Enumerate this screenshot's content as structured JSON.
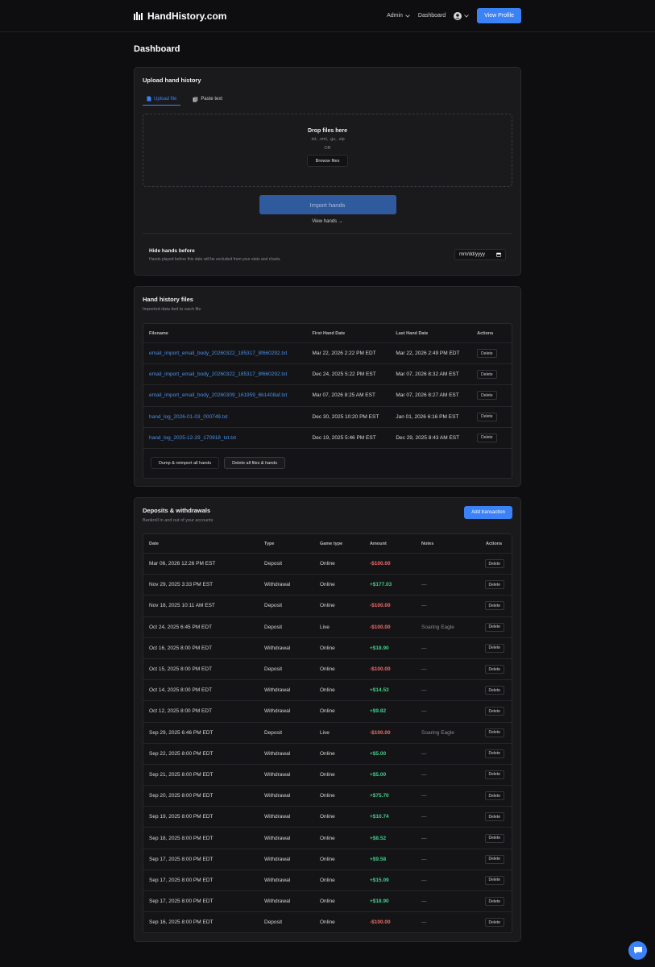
{
  "nav": {
    "brand": "HandHistory.com",
    "admin": "Admin",
    "dashboard": "Dashboard",
    "view_profile": "View Profile"
  },
  "page": {
    "title": "Dashboard"
  },
  "upload": {
    "title": "Upload hand history",
    "tabs": [
      {
        "label": "Upload file"
      },
      {
        "label": "Paste text"
      }
    ],
    "drop_title": "Drop files here",
    "types": ".txt, .xml, .gz, .zip",
    "or": "OR",
    "browse": "Browse files",
    "import": "Import hands",
    "view_hands": "View hands →",
    "hide_title": "Hide hands before",
    "hide_sub": "Hands played before this date will be excluded from your stats and charts.",
    "date_placeholder": "mm/dd/yyyy"
  },
  "files": {
    "title": "Hand history files",
    "subtitle": "Imported data tied to each file",
    "headers": {
      "filename": "Filename",
      "first": "First Hand Date",
      "last": "Last Hand Date",
      "actions": "Actions"
    },
    "rows": [
      {
        "filename": "email_import_email_body_20260322_185317_8f660292.txt",
        "first": "Mar 22, 2026 2:22 PM EDT",
        "last": "Mar 22, 2026 2:49 PM EDT",
        "action": "Delete"
      },
      {
        "filename": "email_import_email_body_20260322_185317_8f660292.txt",
        "first": "Dec 24, 2025 5:22 PM EST",
        "last": "Mar 07, 2026 8:32 AM EST",
        "action": "Delete"
      },
      {
        "filename": "email_import_email_body_20260309_161959_6b1408af.txt",
        "first": "Mar 07, 2026 8:25 AM EST",
        "last": "Mar 07, 2026 8:27 AM EST",
        "action": "Delete"
      },
      {
        "filename": "hand_log_2026-01-03_000749.txt",
        "first": "Dec 30, 2025 10:20 PM EST",
        "last": "Jan 01, 2026 6:16 PM EST",
        "action": "Delete"
      },
      {
        "filename": "hand_log_2025-12-29_170918_txt.txt",
        "first": "Dec 19, 2025 5:46 PM EST",
        "last": "Dec 29, 2025 8:43 AM EST",
        "action": "Delete"
      }
    ],
    "dump_btn": "Dump & reimport all hands",
    "delete_all_btn": "Delete all files & hands"
  },
  "deposits": {
    "title": "Deposits & withdrawals",
    "subtitle": "Bankroll in and out of your accounts",
    "add_btn": "Add transaction",
    "headers": {
      "date": "Date",
      "type": "Type",
      "game": "Game type",
      "amount": "Amount",
      "notes": "Notes",
      "actions": "Actions"
    },
    "rows": [
      {
        "date": "Mar 06, 2026 12:26 PM EST",
        "type": "Deposit",
        "game": "Online",
        "amount": "-$100.00",
        "sign": "neg",
        "notes": "",
        "action": "Delete"
      },
      {
        "date": "Nov 29, 2025 3:33 PM EST",
        "type": "Withdrawal",
        "game": "Online",
        "amount": "+$177.03",
        "sign": "pos",
        "notes": "—",
        "action": "Delete"
      },
      {
        "date": "Nov 18, 2025 10:11 AM EST",
        "type": "Deposit",
        "game": "Online",
        "amount": "-$100.00",
        "sign": "neg",
        "notes": "—",
        "action": "Delete"
      },
      {
        "date": "Oct 24, 2025 6:45 PM EDT",
        "type": "Deposit",
        "game": "Live",
        "amount": "-$100.00",
        "sign": "neg",
        "notes": "Soaring Eagle",
        "action": "Delete"
      },
      {
        "date": "Oct 16, 2025 8:00 PM EDT",
        "type": "Withdrawal",
        "game": "Online",
        "amount": "+$18.90",
        "sign": "pos",
        "notes": "—",
        "action": "Delete"
      },
      {
        "date": "Oct 15, 2025 8:00 PM EDT",
        "type": "Deposit",
        "game": "Online",
        "amount": "-$100.00",
        "sign": "neg",
        "notes": "—",
        "action": "Delete"
      },
      {
        "date": "Oct 14, 2025 8:00 PM EDT",
        "type": "Withdrawal",
        "game": "Online",
        "amount": "+$14.53",
        "sign": "pos",
        "notes": "—",
        "action": "Delete"
      },
      {
        "date": "Oct 12, 2025 8:00 PM EDT",
        "type": "Withdrawal",
        "game": "Online",
        "amount": "+$9.82",
        "sign": "pos",
        "notes": "—",
        "action": "Delete"
      },
      {
        "date": "Sep 29, 2025 6:46 PM EDT",
        "type": "Deposit",
        "game": "Live",
        "amount": "-$100.00",
        "sign": "neg",
        "notes": "Soaring Eagle",
        "action": "Delete"
      },
      {
        "date": "Sep 22, 2025 8:00 PM EDT",
        "type": "Withdrawal",
        "game": "Online",
        "amount": "+$5.00",
        "sign": "pos",
        "notes": "—",
        "action": "Delete"
      },
      {
        "date": "Sep 21, 2025 8:00 PM EDT",
        "type": "Withdrawal",
        "game": "Online",
        "amount": "+$5.00",
        "sign": "pos",
        "notes": "—",
        "action": "Delete"
      },
      {
        "date": "Sep 20, 2025 8:00 PM EDT",
        "type": "Withdrawal",
        "game": "Online",
        "amount": "+$75.70",
        "sign": "pos",
        "notes": "—",
        "action": "Delete"
      },
      {
        "date": "Sep 19, 2025 8:00 PM EDT",
        "type": "Withdrawal",
        "game": "Online",
        "amount": "+$10.74",
        "sign": "pos",
        "notes": "—",
        "action": "Delete"
      },
      {
        "date": "Sep 18, 2025 8:00 PM EDT",
        "type": "Withdrawal",
        "game": "Online",
        "amount": "+$8.52",
        "sign": "pos",
        "notes": "—",
        "action": "Delete"
      },
      {
        "date": "Sep 17, 2025 8:00 PM EDT",
        "type": "Withdrawal",
        "game": "Online",
        "amount": "+$9.58",
        "sign": "pos",
        "notes": "—",
        "action": "Delete"
      },
      {
        "date": "Sep 17, 2025 8:00 PM EDT",
        "type": "Withdrawal",
        "game": "Online",
        "amount": "+$15.09",
        "sign": "pos",
        "notes": "—",
        "action": "Delete"
      },
      {
        "date": "Sep 17, 2025 8:00 PM EDT",
        "type": "Withdrawal",
        "game": "Online",
        "amount": "+$18.90",
        "sign": "pos",
        "notes": "—",
        "action": "Delete"
      },
      {
        "date": "Sep 16, 2025 8:00 PM EDT",
        "type": "Deposit",
        "game": "Online",
        "amount": "-$100.00",
        "sign": "neg",
        "notes": "—",
        "action": "Delete"
      }
    ]
  }
}
